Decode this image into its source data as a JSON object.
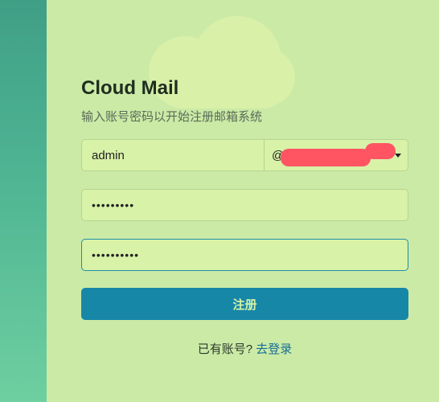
{
  "header": {
    "title": "Cloud Mail",
    "subtitle": "输入账号密码以开始注册邮箱系统"
  },
  "form": {
    "email": {
      "value": "admin",
      "domain_prefix": "@"
    },
    "password": {
      "masked": "•••••••••"
    },
    "confirm_password": {
      "masked": "••••••••••"
    },
    "submit_label": "注册"
  },
  "footer": {
    "prompt": "已有账号?",
    "login_link": "去登录"
  },
  "colors": {
    "panel_bg": "#cbeaa6",
    "input_bg": "#d8f2a8",
    "primary": "#1787a8",
    "link": "#176f97",
    "redaction": "#ff5563"
  }
}
